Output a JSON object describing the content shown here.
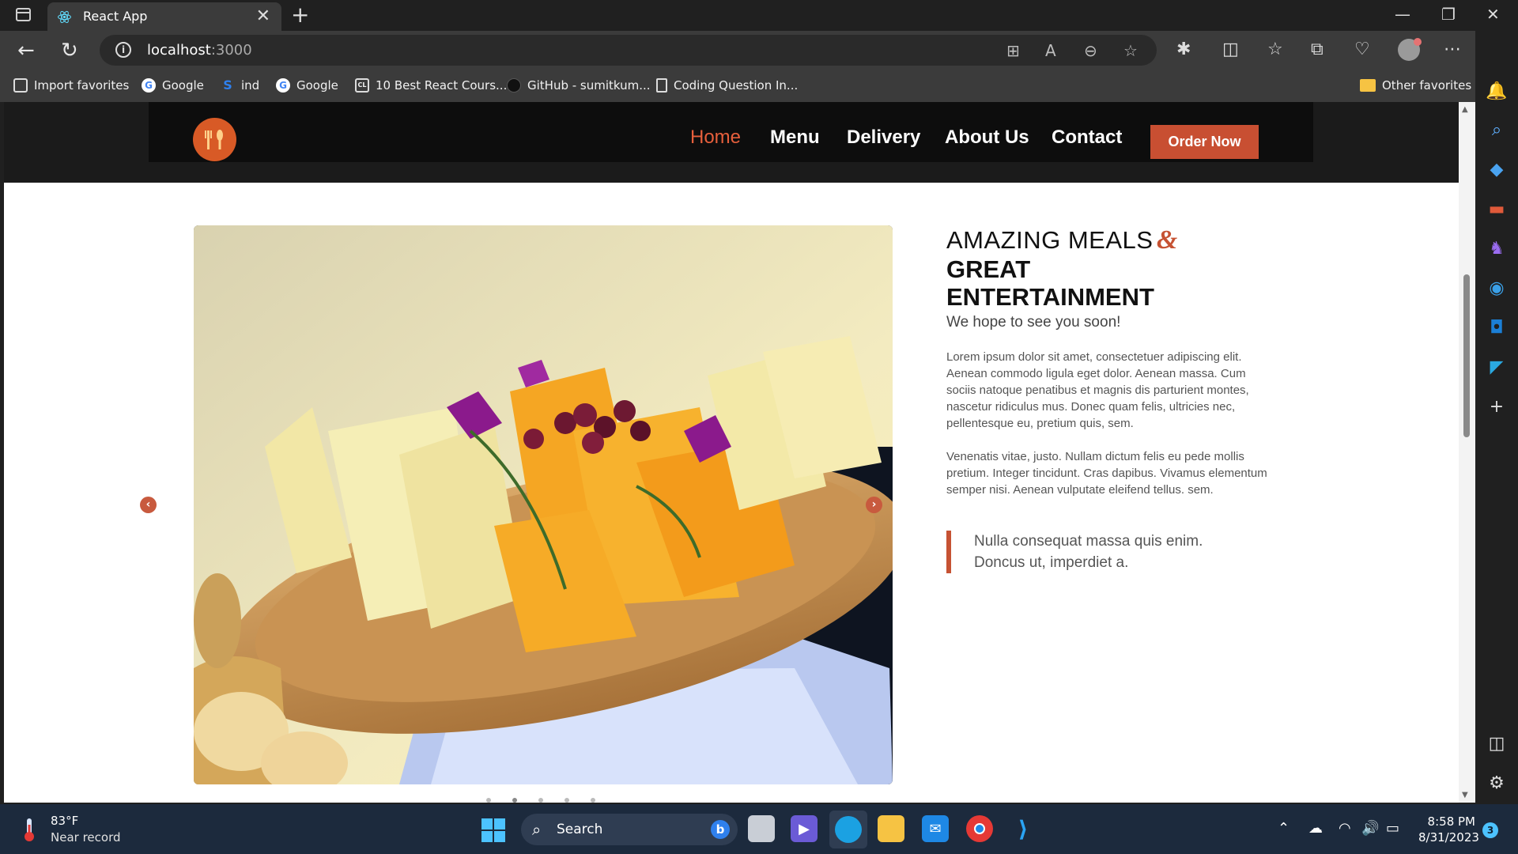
{
  "browser": {
    "tab_title": "React App",
    "url_host": "localhost",
    "url_port": ":3000",
    "favorites": [
      {
        "label": "Import favorites",
        "icon": "import-icon"
      },
      {
        "label": "Google",
        "icon": "google-icon"
      },
      {
        "label": "ind",
        "icon": "s-icon"
      },
      {
        "label": "Google",
        "icon": "google-icon"
      },
      {
        "label": "10 Best React Cours...",
        "icon": "course-icon"
      },
      {
        "label": "GitHub - sumitkum...",
        "icon": "github-icon"
      },
      {
        "label": "Coding Question In...",
        "icon": "page-icon"
      }
    ],
    "other_favorites": "Other favorites"
  },
  "site": {
    "nav": [
      "Home",
      "Menu",
      "Delivery",
      "About Us",
      "Contact"
    ],
    "active_nav": "Home",
    "order_button": "Order Now",
    "accent_color": "#c65233"
  },
  "hero": {
    "title_line1": "AMAZING MEALS",
    "ampersand": "&",
    "title_line2": "GREAT",
    "title_line3": "ENTERTAINMENT",
    "subtitle": "We hope to see you soon!",
    "para1": "Lorem ipsum dolor sit amet, consectetuer adipiscing elit. Aenean commodo ligula eget dolor. Aenean massa. Cum sociis natoque penatibus et magnis dis parturient montes, nascetur ridiculus mus. Donec quam felis, ultricies nec, pellentesque eu, pretium quis, sem.",
    "para2": "Venenatis vitae, justo. Nullam dictum felis eu pede mollis pretium. Integer tincidunt. Cras dapibus. Vivamus elementum semper nisi. Aenean vulputate eleifend tellus. sem.",
    "quote": "Nulla consequat massa quis enim. Doncus ut, imperdiet a."
  },
  "taskbar": {
    "weather_temp": "83°F",
    "weather_status": "Near record",
    "search_label": "Search",
    "time": "8:58 PM",
    "date": "8/31/2023",
    "notification_count": "3"
  }
}
